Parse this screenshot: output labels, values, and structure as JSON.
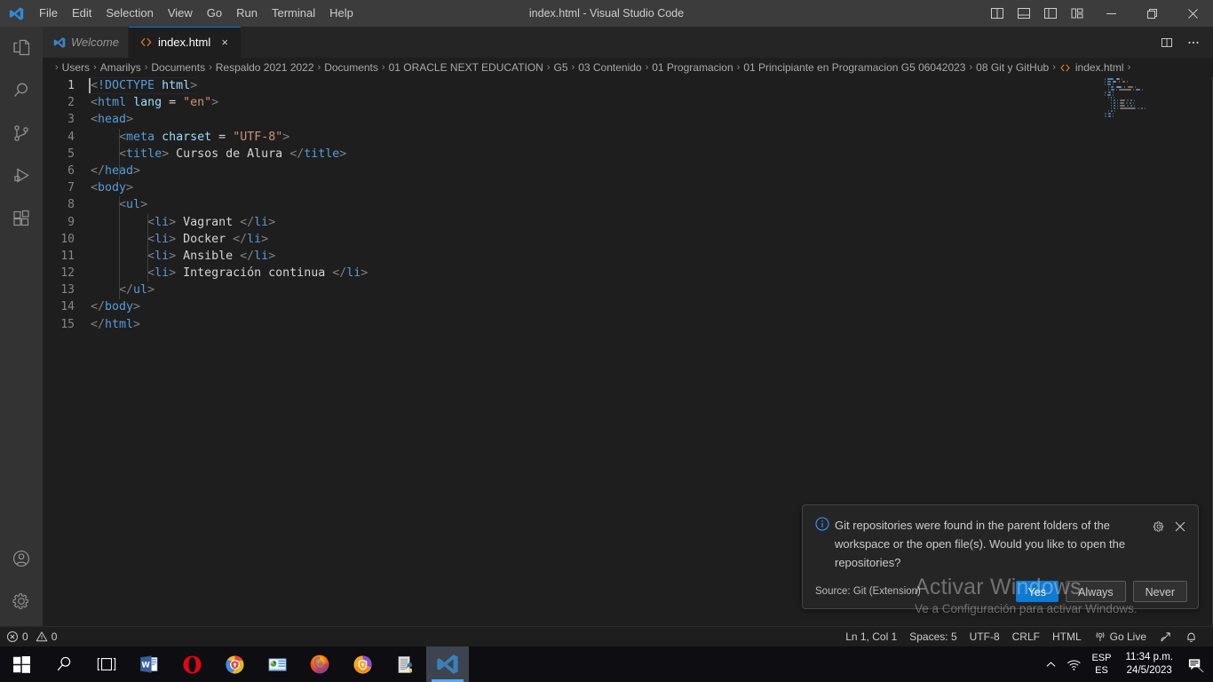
{
  "window": {
    "title": "index.html - Visual Studio Code",
    "menu": [
      "File",
      "Edit",
      "Selection",
      "View",
      "Go",
      "Run",
      "Terminal",
      "Help"
    ],
    "layout_icons": [
      "split-editor-icon",
      "toggle-panel-icon",
      "toggle-sidebar-icon",
      "customize-layout-icon"
    ],
    "controls": {
      "minimize": "minimize-icon",
      "maximize": "maximize-icon",
      "close": "close-icon"
    }
  },
  "activitybar": {
    "items": [
      {
        "name": "explorer",
        "icon": "files-icon",
        "active": false
      },
      {
        "name": "search",
        "icon": "search-icon",
        "active": false
      },
      {
        "name": "source-control",
        "icon": "source-control-icon",
        "active": false
      },
      {
        "name": "run-and-debug",
        "icon": "run-debug-icon",
        "active": false
      },
      {
        "name": "extensions",
        "icon": "extensions-icon",
        "active": false
      }
    ],
    "bottom": [
      {
        "name": "accounts",
        "icon": "account-icon"
      },
      {
        "name": "manage",
        "icon": "gear-icon"
      }
    ]
  },
  "tabs": [
    {
      "label": "Welcome",
      "icon": "vscode-logo-icon",
      "active": false,
      "preview": true,
      "closable": false
    },
    {
      "label": "index.html",
      "icon": "html-file-icon",
      "active": true,
      "preview": false,
      "closable": true,
      "close_label": "×"
    }
  ],
  "tab_actions": [
    "split-editor-right-icon",
    "more-actions-icon"
  ],
  "breadcrumb": {
    "separator": "›",
    "items": [
      "Users",
      "Amarilys",
      "Documents",
      "Respaldo 2021 2022",
      "Documents",
      "01 ORACLE NEXT EDUCATION",
      "G5",
      "03 Contenido",
      "01 Programacion",
      "01 Principiante en Programacion G5 06042023",
      "08 Git y GitHub"
    ],
    "file": "index.html"
  },
  "code": {
    "language": "html",
    "cursor_line": 1,
    "lines": [
      {
        "n": 1,
        "tokens": [
          {
            "t": "punct",
            "v": "<"
          },
          {
            "t": "doctype",
            "v": "!DOCTYPE"
          },
          {
            "t": "txt",
            "v": " "
          },
          {
            "t": "attr",
            "v": "html"
          },
          {
            "t": "punct",
            "v": ">"
          }
        ]
      },
      {
        "n": 2,
        "tokens": [
          {
            "t": "punct",
            "v": "<"
          },
          {
            "t": "tag",
            "v": "html"
          },
          {
            "t": "txt",
            "v": " "
          },
          {
            "t": "attr",
            "v": "lang"
          },
          {
            "t": "txt",
            "v": " "
          },
          {
            "t": "eq",
            "v": "="
          },
          {
            "t": "txt",
            "v": " "
          },
          {
            "t": "str",
            "v": "\"en\""
          },
          {
            "t": "punct",
            "v": ">"
          }
        ]
      },
      {
        "n": 3,
        "tokens": [
          {
            "t": "punct",
            "v": "<"
          },
          {
            "t": "tag",
            "v": "head"
          },
          {
            "t": "punct",
            "v": ">"
          }
        ]
      },
      {
        "n": 4,
        "tokens": [
          {
            "t": "txt",
            "v": "    "
          },
          {
            "t": "punct",
            "v": "<"
          },
          {
            "t": "tag",
            "v": "meta"
          },
          {
            "t": "txt",
            "v": " "
          },
          {
            "t": "attr",
            "v": "charset"
          },
          {
            "t": "txt",
            "v": " "
          },
          {
            "t": "eq",
            "v": "="
          },
          {
            "t": "txt",
            "v": " "
          },
          {
            "t": "str",
            "v": "\"UTF-8\""
          },
          {
            "t": "punct",
            "v": ">"
          }
        ]
      },
      {
        "n": 5,
        "tokens": [
          {
            "t": "txt",
            "v": "    "
          },
          {
            "t": "punct",
            "v": "<"
          },
          {
            "t": "tag",
            "v": "title"
          },
          {
            "t": "punct",
            "v": ">"
          },
          {
            "t": "txt",
            "v": " Cursos de Alura "
          },
          {
            "t": "punct",
            "v": "</"
          },
          {
            "t": "tag",
            "v": "title"
          },
          {
            "t": "punct",
            "v": ">"
          }
        ]
      },
      {
        "n": 6,
        "tokens": [
          {
            "t": "punct",
            "v": "</"
          },
          {
            "t": "tag",
            "v": "head"
          },
          {
            "t": "punct",
            "v": ">"
          }
        ]
      },
      {
        "n": 7,
        "tokens": [
          {
            "t": "punct",
            "v": "<"
          },
          {
            "t": "tag",
            "v": "body"
          },
          {
            "t": "punct",
            "v": ">"
          }
        ]
      },
      {
        "n": 8,
        "tokens": [
          {
            "t": "txt",
            "v": "    "
          },
          {
            "t": "punct",
            "v": "<"
          },
          {
            "t": "tag",
            "v": "ul"
          },
          {
            "t": "punct",
            "v": ">"
          }
        ]
      },
      {
        "n": 9,
        "tokens": [
          {
            "t": "txt",
            "v": "        "
          },
          {
            "t": "punct",
            "v": "<"
          },
          {
            "t": "tag",
            "v": "li"
          },
          {
            "t": "punct",
            "v": ">"
          },
          {
            "t": "txt",
            "v": " Vagrant "
          },
          {
            "t": "punct",
            "v": "</"
          },
          {
            "t": "tag",
            "v": "li"
          },
          {
            "t": "punct",
            "v": ">"
          }
        ]
      },
      {
        "n": 10,
        "tokens": [
          {
            "t": "txt",
            "v": "        "
          },
          {
            "t": "punct",
            "v": "<"
          },
          {
            "t": "tag",
            "v": "li"
          },
          {
            "t": "punct",
            "v": ">"
          },
          {
            "t": "txt",
            "v": " Docker "
          },
          {
            "t": "punct",
            "v": "</"
          },
          {
            "t": "tag",
            "v": "li"
          },
          {
            "t": "punct",
            "v": ">"
          }
        ]
      },
      {
        "n": 11,
        "tokens": [
          {
            "t": "txt",
            "v": "        "
          },
          {
            "t": "punct",
            "v": "<"
          },
          {
            "t": "tag",
            "v": "li"
          },
          {
            "t": "punct",
            "v": ">"
          },
          {
            "t": "txt",
            "v": " Ansible "
          },
          {
            "t": "punct",
            "v": "</"
          },
          {
            "t": "tag",
            "v": "li"
          },
          {
            "t": "punct",
            "v": ">"
          }
        ]
      },
      {
        "n": 12,
        "tokens": [
          {
            "t": "txt",
            "v": "        "
          },
          {
            "t": "punct",
            "v": "<"
          },
          {
            "t": "tag",
            "v": "li"
          },
          {
            "t": "punct",
            "v": ">"
          },
          {
            "t": "txt",
            "v": " Integración continua "
          },
          {
            "t": "punct",
            "v": "</"
          },
          {
            "t": "tag",
            "v": "li"
          },
          {
            "t": "punct",
            "v": ">"
          }
        ]
      },
      {
        "n": 13,
        "tokens": [
          {
            "t": "txt",
            "v": "    "
          },
          {
            "t": "punct",
            "v": "</"
          },
          {
            "t": "tag",
            "v": "ul"
          },
          {
            "t": "punct",
            "v": ">"
          }
        ]
      },
      {
        "n": 14,
        "tokens": [
          {
            "t": "punct",
            "v": "</"
          },
          {
            "t": "tag",
            "v": "body"
          },
          {
            "t": "punct",
            "v": ">"
          }
        ]
      },
      {
        "n": 15,
        "tokens": [
          {
            "t": "punct",
            "v": "</"
          },
          {
            "t": "tag",
            "v": "html"
          },
          {
            "t": "punct",
            "v": ">"
          }
        ]
      }
    ]
  },
  "notification": {
    "icon": "info-icon",
    "message": "Git repositories were found in the parent folders of the workspace or the open file(s). Would you like to open the repositories?",
    "source": "Source: Git (Extension)",
    "gear_icon": "gear-icon",
    "close_icon": "close-icon",
    "buttons": [
      {
        "label": "Yes",
        "primary": true
      },
      {
        "label": "Always",
        "primary": false
      },
      {
        "label": "Never",
        "primary": false
      }
    ]
  },
  "watermark": {
    "line1": "Activar Windows",
    "line2": "Ve a Configuración para activar Windows."
  },
  "statusbar": {
    "errors": "0",
    "warnings": "0",
    "error_icon": "error-icon",
    "warning_icon": "warning-icon",
    "right": [
      {
        "label": "Ln 1, Col 1",
        "icon": null
      },
      {
        "label": "Spaces: 5",
        "icon": null
      },
      {
        "label": "UTF-8",
        "icon": null
      },
      {
        "label": "CRLF",
        "icon": null
      },
      {
        "label": "HTML",
        "icon": null
      },
      {
        "label": "Go Live",
        "icon": "broadcast-icon"
      }
    ],
    "feedback_icon": "feedback-icon",
    "bell_icon": "bell-icon"
  },
  "taskbar": {
    "items": [
      {
        "name": "start",
        "icon": "windows-start-icon"
      },
      {
        "name": "search",
        "icon": "search-icon"
      },
      {
        "name": "task-view",
        "icon": "task-view-icon"
      },
      {
        "name": "word",
        "icon": "word-icon"
      },
      {
        "name": "opera",
        "icon": "opera-icon"
      },
      {
        "name": "chrome-secure",
        "icon": "chrome-shield-icon"
      },
      {
        "name": "outlook-contacts",
        "icon": "contacts-icon"
      },
      {
        "name": "firefox",
        "icon": "firefox-icon"
      },
      {
        "name": "avast-browser",
        "icon": "avast-browser-icon"
      },
      {
        "name": "python-idle",
        "icon": "python-file-icon"
      },
      {
        "name": "visual-studio-code",
        "icon": "vscode-icon",
        "running": true
      }
    ],
    "tray": {
      "chevron_icon": "chevron-up-icon",
      "network_icon": "wifi-icon",
      "lang_top": "ESP",
      "lang_bottom": "ES",
      "time": "11:34 p.m.",
      "date": "24/5/2023",
      "action_center_icon": "notification-icon"
    }
  },
  "colors": {
    "accent": "#0078d4",
    "titlebar_bg": "#3c3c3c",
    "activitybar_bg": "#333333",
    "editor_bg": "#1e1e1e",
    "tab_inactive_bg": "#2d2d2d",
    "button_primary": "#0e7ad4",
    "taskbar_bg": "#0d0d12"
  }
}
